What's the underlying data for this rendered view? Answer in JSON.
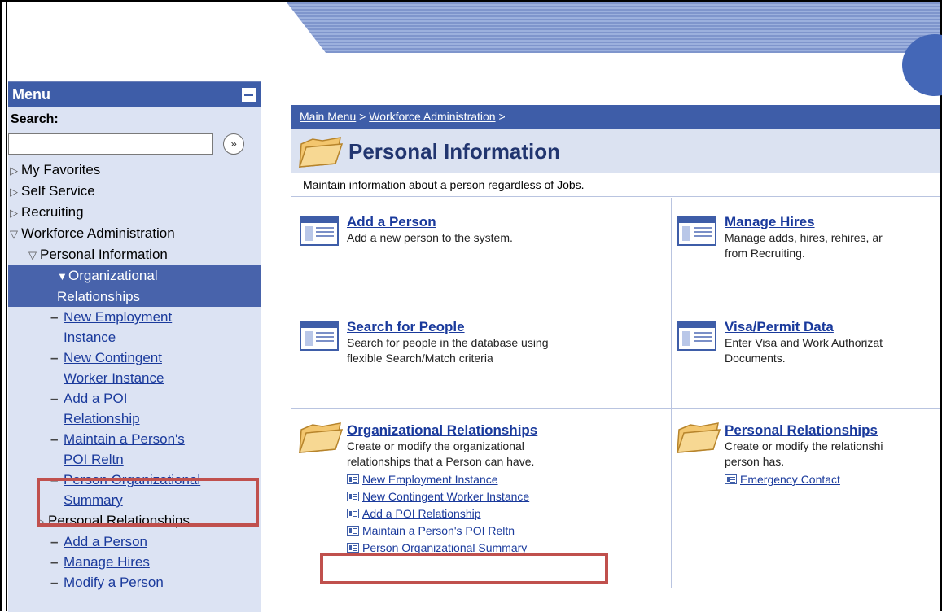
{
  "menu": {
    "title": "Menu",
    "search_label": "Search:",
    "search_value": "",
    "search_go": "»",
    "items": [
      {
        "label": "My Favorites"
      },
      {
        "label": "Self Service"
      },
      {
        "label": "Recruiting"
      },
      {
        "label": "Workforce Administration"
      },
      {
        "label": "Personal Information"
      },
      {
        "label_line1": "Organizational",
        "label_line2": "Relationships"
      },
      {
        "label_line1": "New Employment",
        "label_line2": "Instance"
      },
      {
        "label_line1": "New Contingent",
        "label_line2": "Worker Instance"
      },
      {
        "label_line1": "Add a POI",
        "label_line2": "Relationship"
      },
      {
        "label_line1": "Maintain a Person's",
        "label_line2": "POI Reltn"
      },
      {
        "label_line1": "Person Organizational",
        "label_line2": "Summary"
      },
      {
        "label": "Personal Relationships"
      },
      {
        "label": "Add a Person"
      },
      {
        "label": "Manage Hires"
      },
      {
        "label": "Modify a Person"
      }
    ]
  },
  "breadcrumb": {
    "main_menu": "Main Menu",
    "sep1": " > ",
    "workforce": "Workforce Administration",
    "sep2": " >"
  },
  "page": {
    "title": "Personal Information",
    "description": "Maintain information about a person regardless of Jobs."
  },
  "cells": {
    "add_person": {
      "title": "Add a Person",
      "desc": "Add a new person to the system."
    },
    "manage_hires": {
      "title": "Manage Hires",
      "desc_line1": "Manage adds, hires, rehires, ar",
      "desc_line2": "from Recruiting."
    },
    "search_people": {
      "title": "Search for People",
      "desc_line1": "Search for people in the database using",
      "desc_line2": "flexible Search/Match criteria"
    },
    "visa": {
      "title": "Visa/Permit Data",
      "desc_line1": "Enter Visa and Work Authorizat",
      "desc_line2": "Documents."
    },
    "org_rel": {
      "title": "Organizational Relationships",
      "desc_line1": "Create or modify the organizational",
      "desc_line2": "relationships that a Person can have.",
      "links": [
        "New Employment Instance",
        "New Contingent Worker Instance",
        "Add a POI Relationship",
        "Maintain a Person's POI Reltn",
        "Person Organizational Summary"
      ]
    },
    "pers_rel": {
      "title": "Personal Relationships",
      "desc_line1": "Create or modify the relationshi",
      "desc_line2": "person has.",
      "links": [
        "Emergency Contact"
      ]
    }
  }
}
